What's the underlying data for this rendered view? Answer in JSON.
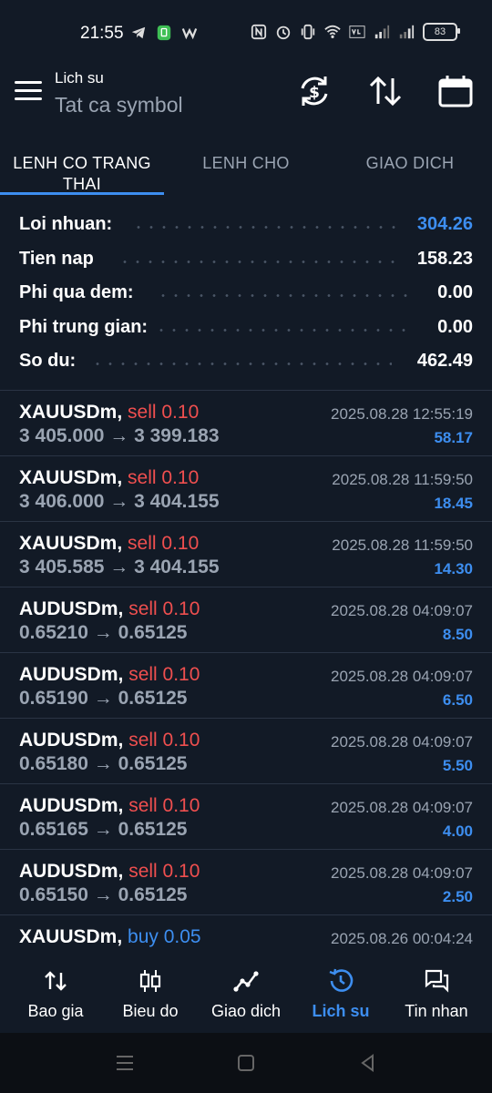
{
  "status_bar": {
    "time": "21:55",
    "battery": "83"
  },
  "header": {
    "title": "Lich su",
    "subtitle": "Tat ca symbol"
  },
  "tabs": [
    {
      "label": "LENH CO TRANG THAI",
      "active": true
    },
    {
      "label": "LENH CHO",
      "active": false
    },
    {
      "label": "GIAO DICH",
      "active": false
    }
  ],
  "summary": [
    {
      "label": "Loi nhuan:",
      "value": "304.26",
      "highlight": true
    },
    {
      "label": "Tien nap",
      "value": "158.23",
      "highlight": false
    },
    {
      "label": "Phi qua dem:",
      "value": "0.00",
      "highlight": false
    },
    {
      "label": "Phi trung gian:",
      "value": "0.00",
      "highlight": false
    },
    {
      "label": "So du:",
      "value": "462.49",
      "highlight": false
    }
  ],
  "trades": [
    {
      "symbol": "XAUUSDm,",
      "side": "sell 0.10",
      "side_type": "sell",
      "prices": "3 405.000 → 3 399.183",
      "time": "2025.08.28 12:55:19",
      "profit": "58.17"
    },
    {
      "symbol": "XAUUSDm,",
      "side": "sell 0.10",
      "side_type": "sell",
      "prices": "3 406.000 → 3 404.155",
      "time": "2025.08.28 11:59:50",
      "profit": "18.45"
    },
    {
      "symbol": "XAUUSDm,",
      "side": "sell 0.10",
      "side_type": "sell",
      "prices": "3 405.585 → 3 404.155",
      "time": "2025.08.28 11:59:50",
      "profit": "14.30"
    },
    {
      "symbol": "AUDUSDm,",
      "side": "sell 0.10",
      "side_type": "sell",
      "prices": "0.65210 → 0.65125",
      "time": "2025.08.28 04:09:07",
      "profit": "8.50"
    },
    {
      "symbol": "AUDUSDm,",
      "side": "sell 0.10",
      "side_type": "sell",
      "prices": "0.65190 → 0.65125",
      "time": "2025.08.28 04:09:07",
      "profit": "6.50"
    },
    {
      "symbol": "AUDUSDm,",
      "side": "sell 0.10",
      "side_type": "sell",
      "prices": "0.65180 → 0.65125",
      "time": "2025.08.28 04:09:07",
      "profit": "5.50"
    },
    {
      "symbol": "AUDUSDm,",
      "side": "sell 0.10",
      "side_type": "sell",
      "prices": "0.65165 → 0.65125",
      "time": "2025.08.28 04:09:07",
      "profit": "4.00"
    },
    {
      "symbol": "AUDUSDm,",
      "side": "sell 0.10",
      "side_type": "sell",
      "prices": "0.65150 → 0.65125",
      "time": "2025.08.28 04:09:07",
      "profit": "2.50"
    },
    {
      "symbol": "XAUUSDm,",
      "side": "buy 0.05",
      "side_type": "buy",
      "prices": "",
      "time": "2025.08.26 00:04:24",
      "profit": ""
    }
  ],
  "bottom_nav": [
    {
      "label": "Bao gia",
      "icon": "quotes-icon",
      "active": false
    },
    {
      "label": "Bieu do",
      "icon": "chart-icon",
      "active": false
    },
    {
      "label": "Giao dich",
      "icon": "trade-icon",
      "active": false
    },
    {
      "label": "Lich su",
      "icon": "history-icon",
      "active": true
    },
    {
      "label": "Tin nhan",
      "icon": "messages-icon",
      "active": false
    }
  ],
  "colors": {
    "background": "#121a26",
    "accent": "#3d8ef0",
    "sell": "#ef4f4f",
    "muted": "#9aa4b2"
  }
}
